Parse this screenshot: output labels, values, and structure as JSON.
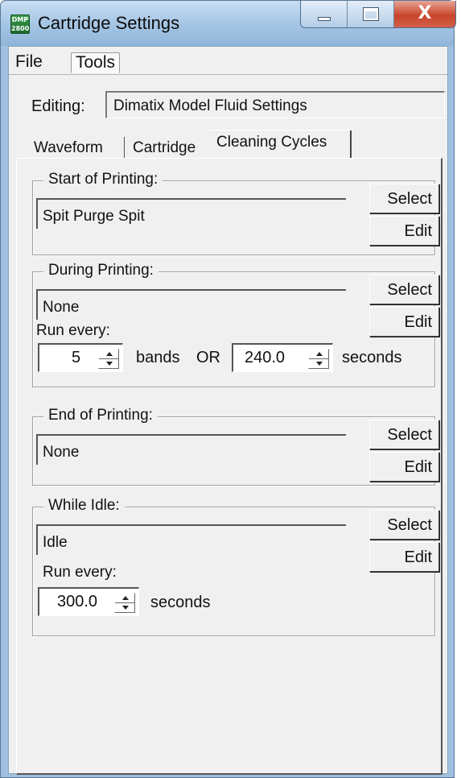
{
  "window": {
    "title": "Cartridge Settings",
    "app_icon_text": "DMP 2800",
    "caption_buttons": [
      "minimize",
      "maximize",
      "close"
    ],
    "close_glyph": "X"
  },
  "menu": {
    "items": [
      "File",
      "Tools"
    ]
  },
  "editing": {
    "label": "Editing:",
    "value": "Dimatix Model Fluid Settings"
  },
  "tabs": [
    {
      "label": "Waveform",
      "selected": false
    },
    {
      "label": "Cartridge",
      "selected": false
    },
    {
      "label": "Cleaning Cycles",
      "selected": true
    }
  ],
  "groups": {
    "start": {
      "title": "Start of Printing:",
      "value": "Spit Purge Spit",
      "select_label": "Select",
      "edit_label": "Edit"
    },
    "during": {
      "title": "During Printing:",
      "value": "None",
      "select_label": "Select",
      "edit_label": "Edit",
      "run_every_label": "Run every:",
      "bands_value": "5",
      "bands_unit": "bands",
      "or_label": "OR",
      "seconds_value": "240.0",
      "seconds_unit": "seconds"
    },
    "end": {
      "title": "End of Printing:",
      "value": "None",
      "select_label": "Select",
      "edit_label": "Edit"
    },
    "idle": {
      "title": "While Idle:",
      "value": "Idle",
      "select_label": "Select",
      "edit_label": "Edit",
      "run_every_label": "Run every:",
      "seconds_value": "300.0",
      "seconds_unit": "seconds"
    }
  }
}
